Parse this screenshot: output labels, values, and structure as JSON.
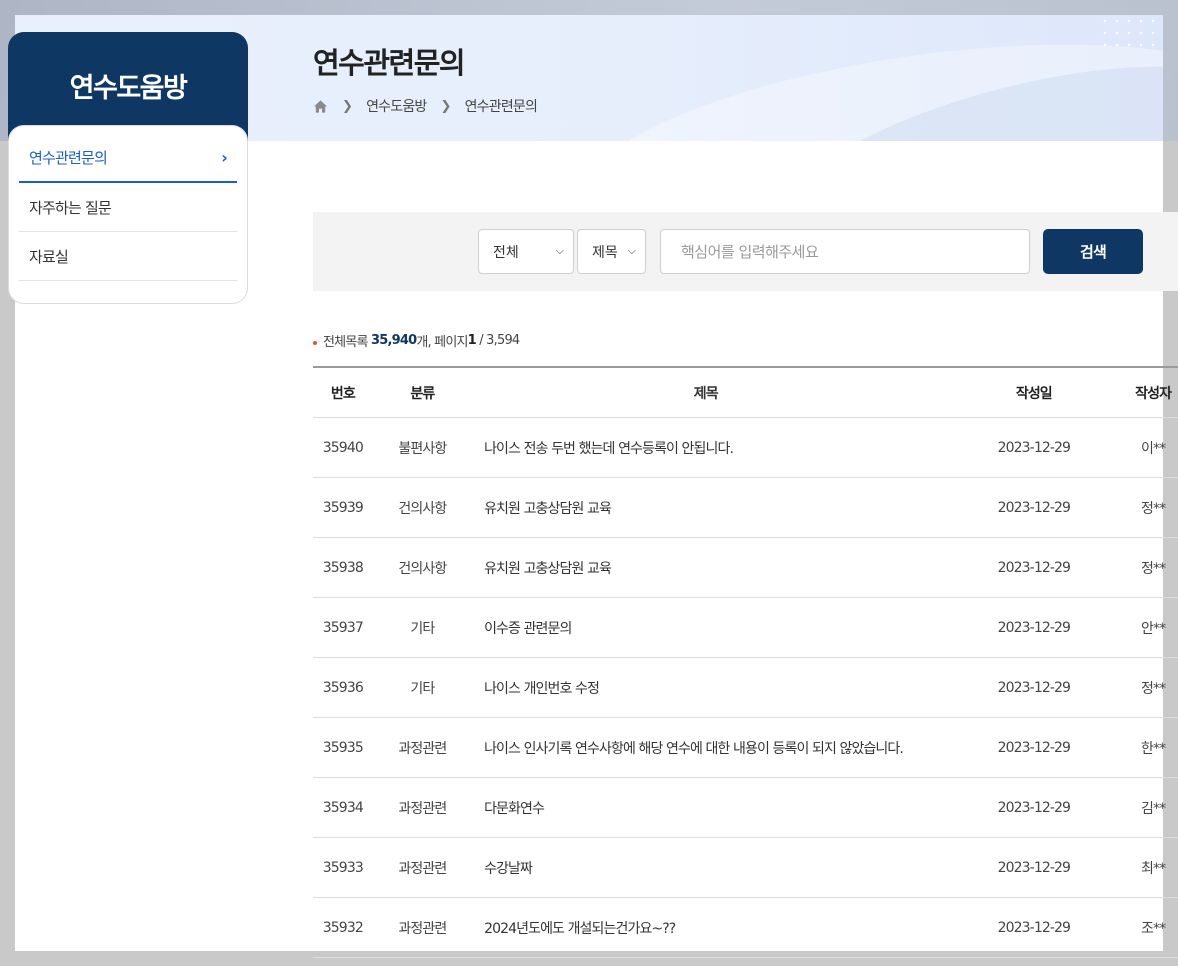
{
  "sidebar": {
    "title": "연수도움방",
    "items": [
      {
        "label": "연수관련문의",
        "active": true
      },
      {
        "label": "자주하는 질문",
        "active": false
      },
      {
        "label": "자료실",
        "active": false
      }
    ]
  },
  "header": {
    "page_title": "연수관련문의",
    "breadcrumb": [
      "연수도움방",
      "연수관련문의"
    ]
  },
  "search": {
    "scope_value": "전체",
    "field_value": "제목",
    "placeholder": "핵심어를 입력해주세요",
    "button_label": "검색"
  },
  "summary": {
    "total_label": "전체목록",
    "total_count": "35,940",
    "count_unit": "개, 페이지",
    "current_page": "1",
    "total_pages": "/ 3,594"
  },
  "table": {
    "headers": {
      "num": "번호",
      "category": "분류",
      "title": "제목",
      "date": "작성일",
      "writer": "작성자"
    },
    "rows": [
      {
        "num": "35940",
        "category": "불편사항",
        "title": "나이스 전송 두번 했는데 연수등록이 안됩니다.",
        "date": "2023-12-29",
        "writer": "이**"
      },
      {
        "num": "35939",
        "category": "건의사항",
        "title": "유치원 고충상담원 교육",
        "date": "2023-12-29",
        "writer": "정**"
      },
      {
        "num": "35938",
        "category": "건의사항",
        "title": "유치원 고충상담원 교육",
        "date": "2023-12-29",
        "writer": "정**"
      },
      {
        "num": "35937",
        "category": "기타",
        "title": "이수증 관련문의",
        "date": "2023-12-29",
        "writer": "안**"
      },
      {
        "num": "35936",
        "category": "기타",
        "title": "나이스 개인번호 수정",
        "date": "2023-12-29",
        "writer": "정**"
      },
      {
        "num": "35935",
        "category": "과정관련",
        "title": "나이스 인사기록 연수사항에 해당 연수에 대한 내용이 등록이 되지 않았습니다.",
        "date": "2023-12-29",
        "writer": "한**"
      },
      {
        "num": "35934",
        "category": "과정관련",
        "title": "다문화연수",
        "date": "2023-12-29",
        "writer": "김**"
      },
      {
        "num": "35933",
        "category": "과정관련",
        "title": "수강날짜",
        "date": "2023-12-29",
        "writer": "최**"
      },
      {
        "num": "35932",
        "category": "과정관련",
        "title": "2024년도에도 개설되는건가요~??",
        "date": "2023-12-29",
        "writer": "조**"
      }
    ]
  },
  "colors": {
    "brand_navy": "#0e3764",
    "active_blue": "#1b5fc8",
    "bullet_red": "#e0533a"
  }
}
